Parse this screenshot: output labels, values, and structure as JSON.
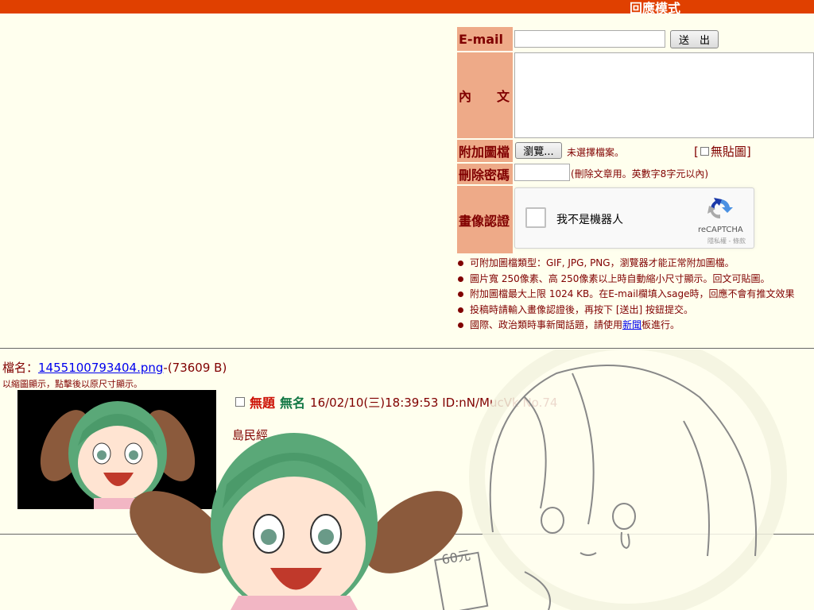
{
  "header": {
    "mode_title": "回應模式"
  },
  "form": {
    "email_label": "E-mail",
    "submit_label": "送　出",
    "content_label": "內　　文",
    "attach_label": "附加圖檔",
    "browse_label": "瀏覽...",
    "no_file_text": "未選擇檔案。",
    "no_image_label": "無貼圖",
    "delete_pw_label": "刪除密碼",
    "delete_pw_note": "(刪除文章用。英數字8字元以內)",
    "captcha_label": "畫像認證",
    "captcha_text": "我不是機器人",
    "captcha_brand": "reCAPTCHA",
    "captcha_links": "隱私權 - 條款"
  },
  "rules": [
    "可附加圖檔類型：GIF, JPG, PNG，瀏覽器才能正常附加圖檔。",
    "圖片寬 250像素、高 250像素以上時自動縮小尺寸顯示。回文可貼圖。",
    "附加圖檔最大上限 1024 KB。在E-mail欄填入sage時，回應不會有推文效果",
    "投稿時請輸入畫像認證後，再按下 [送出] 按鈕提交。",
    "國際、政治類時事新聞話題，請使用新聞板進行。"
  ],
  "rules_last": {
    "before": "國際、政治類時事新聞話題，請使用",
    "link": "新聞",
    "after": "板進行。"
  },
  "post": {
    "file_prefix": "檔名：",
    "file_name": "1455100793404.png",
    "file_size": "-(73609 B)",
    "thumb_note": "以縮圖顯示，點擊後以原尺寸顯示。",
    "subject": "無題",
    "name": "無名",
    "datetime": "16/02/10(三)18:39:53 ID:nN/MucVk No.74",
    "body": "島民經"
  },
  "colors": {
    "topbar": "#e04000",
    "label_bg": "#eeaa88",
    "page_bg": "#ffffee"
  }
}
